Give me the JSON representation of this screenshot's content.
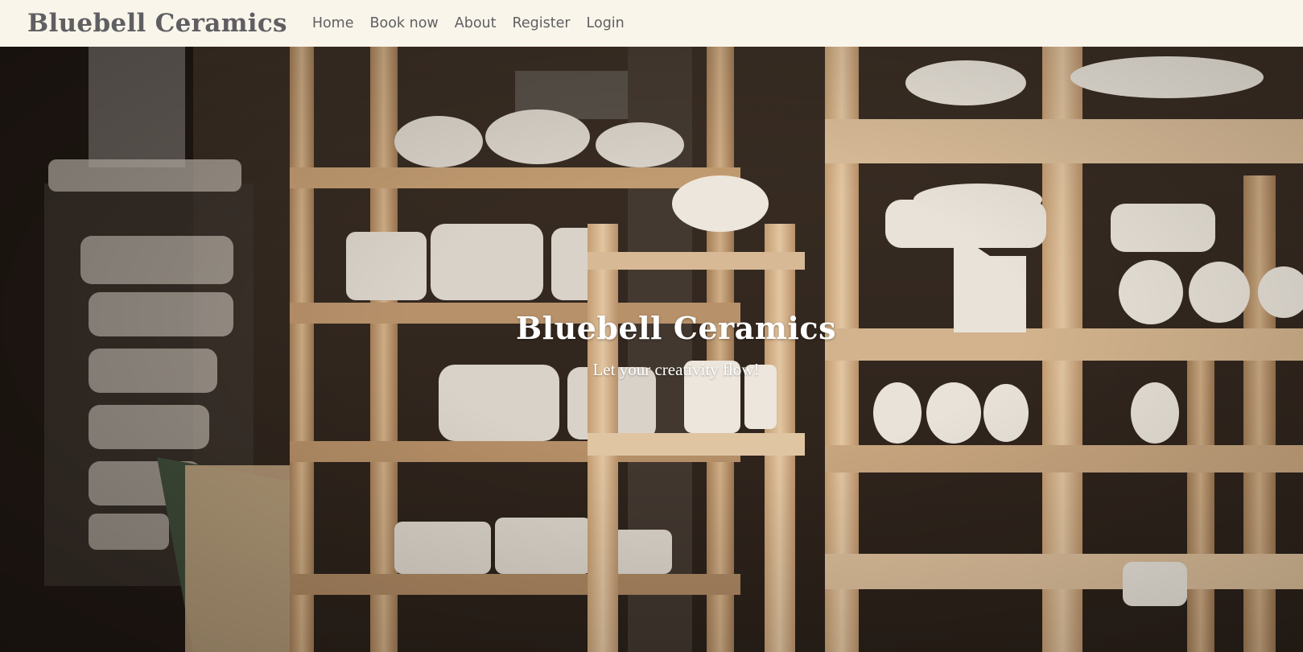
{
  "nav": {
    "brand": "Bluebell Ceramics",
    "links": [
      "Home",
      "Book now",
      "About",
      "Register",
      "Login"
    ]
  },
  "hero": {
    "title": "Bluebell Ceramics",
    "subtitle": "Let your creativity flow!"
  },
  "colors": {
    "navbar_bg": "#faf5ea",
    "nav_text": "#5f5f63",
    "hero_text": "#ffffff",
    "shelf_wood": "#c9a47a"
  }
}
